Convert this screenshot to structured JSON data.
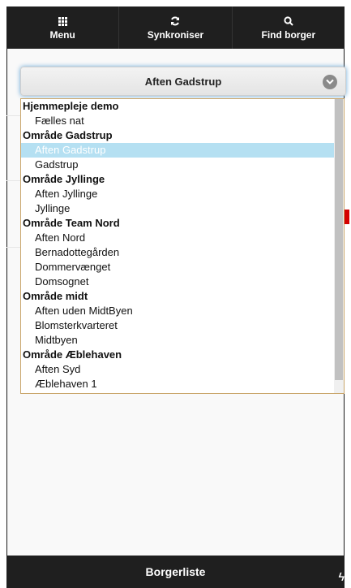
{
  "topbar": {
    "buttons": [
      {
        "label": "Menu",
        "icon": "grid-icon"
      },
      {
        "label": "Synkroniser",
        "icon": "sync-icon"
      },
      {
        "label": "Find borger",
        "icon": "search-icon"
      }
    ]
  },
  "select": {
    "value": "Aften Gadstrup",
    "icon": "chevron-down-icon"
  },
  "dropdown": {
    "options": [
      {
        "label": "Hjemmepleje demo",
        "type": "group"
      },
      {
        "label": "Fælles nat",
        "type": "item"
      },
      {
        "label": "Område Gadstrup",
        "type": "group"
      },
      {
        "label": "Aften Gadstrup",
        "type": "item",
        "selected": true
      },
      {
        "label": "Gadstrup",
        "type": "item"
      },
      {
        "label": "Område Jyllinge",
        "type": "group"
      },
      {
        "label": "Aften Jyllinge",
        "type": "item"
      },
      {
        "label": "Jyllinge",
        "type": "item"
      },
      {
        "label": "Område Team Nord",
        "type": "group"
      },
      {
        "label": "Aften Nord",
        "type": "item"
      },
      {
        "label": "Bernadottegården",
        "type": "item"
      },
      {
        "label": "Dommervænget",
        "type": "item"
      },
      {
        "label": "Domsognet",
        "type": "item"
      },
      {
        "label": "Område midt",
        "type": "group"
      },
      {
        "label": "Aften uden MidtByen",
        "type": "item"
      },
      {
        "label": "Blomsterkvarteret",
        "type": "item"
      },
      {
        "label": "Midtbyen",
        "type": "item"
      },
      {
        "label": "Område Æblehaven",
        "type": "group"
      },
      {
        "label": "Aften Syd",
        "type": "item"
      },
      {
        "label": "Æblehaven 1",
        "type": "item"
      }
    ]
  },
  "footer": {
    "label": "Borgerliste",
    "icon": "bolt-icon"
  },
  "colors": {
    "bar": "#1f1f1f",
    "selected": "#b5e0f2",
    "accent_red": "#d40000"
  }
}
